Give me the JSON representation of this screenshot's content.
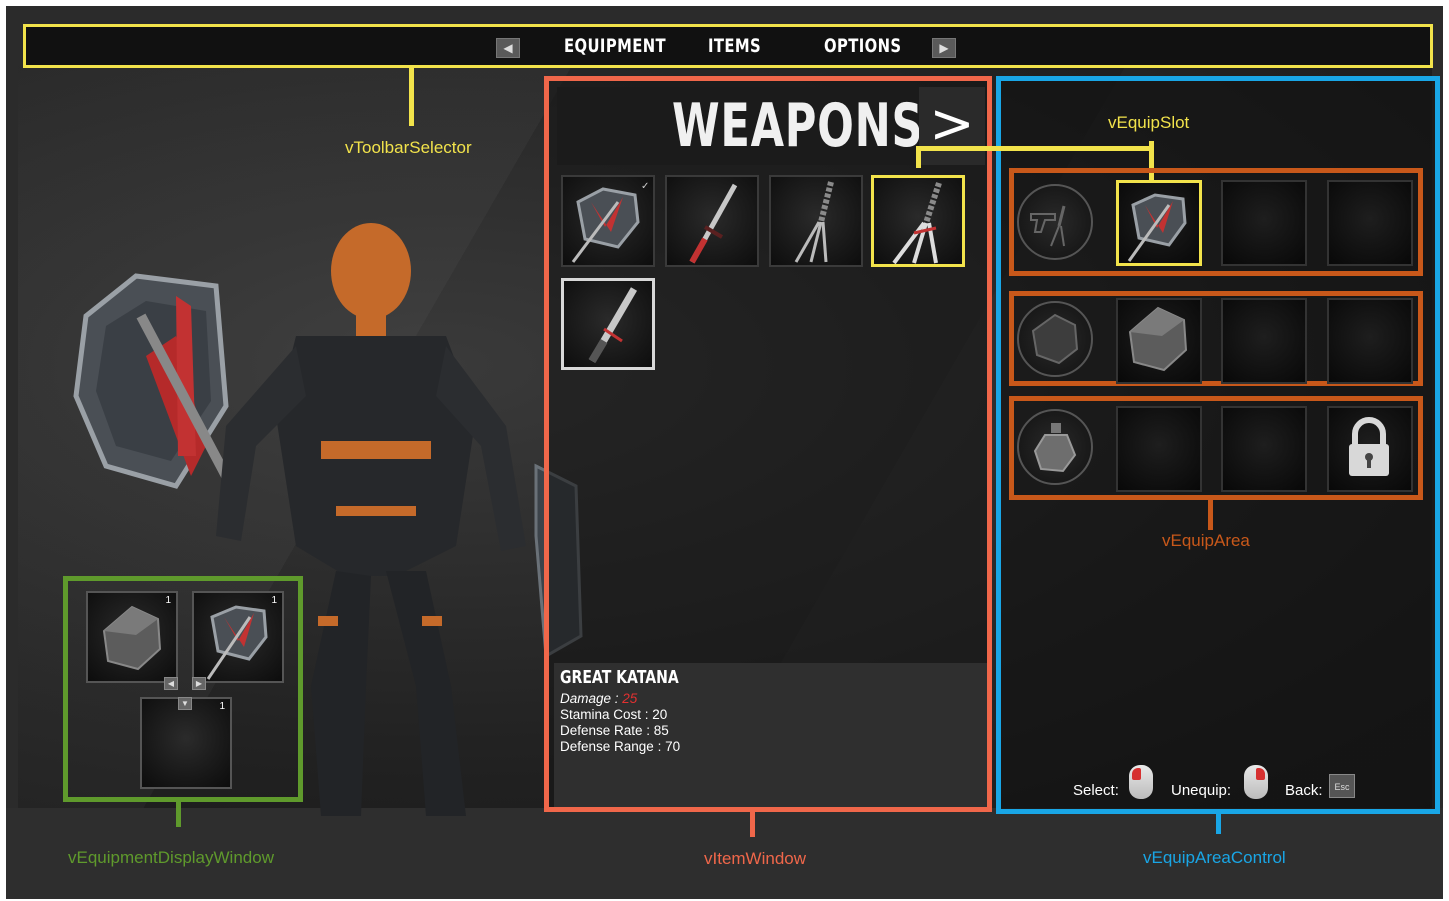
{
  "toolbar": {
    "prev_icon": "left-arrow-icon",
    "tabs": [
      "EQUIPMENT",
      "ITEMS",
      "OPTIONS"
    ],
    "next_icon": "right-arrow-icon"
  },
  "callouts": {
    "toolbar_selector": "vToolbarSelector",
    "equip_slot": "vEquipSlot",
    "equip_area": "vEquipArea",
    "equipment_display_window": "vEquipmentDisplayWindow",
    "item_window": "vItemWindow",
    "equip_area_control": "vEquipAreaControl"
  },
  "item_window": {
    "title": "WEAPONS",
    "next_label": ">",
    "items": [
      {
        "icon": "axe-shield-icon",
        "selected": false
      },
      {
        "icon": "katana-icon",
        "selected": false
      },
      {
        "icon": "claw-blade-icon",
        "selected": false
      },
      {
        "icon": "claw-blade-icon",
        "selected": true
      },
      {
        "icon": "great-katana-icon",
        "selected": false
      }
    ],
    "info": {
      "name": "GREAT KATANA",
      "damage_label": "Damage :",
      "damage_value": "25",
      "stamina": "Stamina Cost : 20",
      "defense_rate": "Defense Rate : 85",
      "defense_range": "Defense Range : 70"
    }
  },
  "equip_control": {
    "hints": {
      "select": "Select:",
      "unequip": "Unequip:",
      "back": "Back:",
      "esc": "Esc"
    }
  },
  "display_window": {
    "counts": [
      "1",
      "1",
      "1"
    ]
  },
  "colors": {
    "toolbar_selector": "#f2e34b",
    "item_window": "#f0674a",
    "equip_area_control": "#19a6e6",
    "equip_area": "#c8581a",
    "display_window": "#5f9a2c",
    "damage_value": "#e23030"
  }
}
